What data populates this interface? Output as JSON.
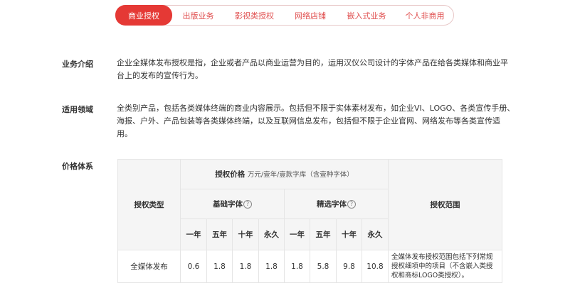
{
  "tabs": [
    {
      "label": "商业授权",
      "active": true
    },
    {
      "label": "出版业务",
      "active": false
    },
    {
      "label": "影视类授权",
      "active": false
    },
    {
      "label": "网络店铺",
      "active": false
    },
    {
      "label": "嵌入式业务",
      "active": false
    },
    {
      "label": "个人非商用",
      "active": false
    }
  ],
  "intro": {
    "label": "业务介绍",
    "text": "企业全媒体发布授权是指，企业或者产品以商业运营为目的，运用汉仪公司设计的字体产品在给各类媒体和商业平台上的发布的宣传行为。"
  },
  "scope": {
    "label": "适用领域",
    "text": "全类别产品，包括各类媒体终端的商业内容展示。包括但不限于实体素材发布，如企业VI、LOGO、各类宣传手册、海报、户外、产品包装等各类媒体终端，以及互联网信息发布，包括但不限于企业官网、网络发布等各类宣传适用。"
  },
  "pricing": {
    "label": "价格体系",
    "table": {
      "type_header": "授权类型",
      "price_header": "授权价格",
      "price_note": "万元/壹年/壹款字库（含壹种字体）",
      "basic_header": "基础字体",
      "premium_header": "精选字体",
      "range_header": "授权范围",
      "periods": [
        "一年",
        "五年",
        "十年",
        "永久"
      ],
      "rows": [
        {
          "type": "全媒体发布",
          "basic": [
            "0.6",
            "1.8",
            "1.8",
            "1.8"
          ],
          "premium": [
            "1.8",
            "5.8",
            "9.8",
            "10.8"
          ],
          "range": "全媒体发布授权范围包括下列常规授权细项中的项目（不含嵌入类授权和商标LOGO类授权）。"
        }
      ]
    }
  },
  "icons": {
    "help": "?"
  },
  "colors": {
    "accent": "#e53935",
    "tab_text": "#e05050",
    "header_bg": "#f5f5f5"
  }
}
